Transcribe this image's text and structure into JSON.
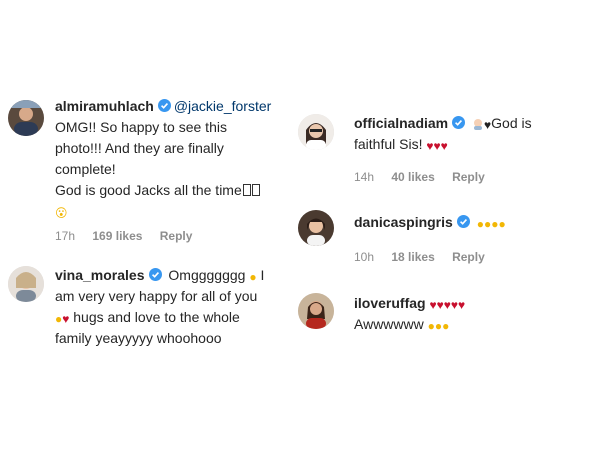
{
  "comments": [
    {
      "username": "almiramuhlach",
      "mention": "@jackie_forster",
      "lines": [
        "OMG!! So happy to see this",
        "photo!!! And they are finally",
        "complete!",
        "God is good Jacks all the time"
      ],
      "trailing_emoji": "😮",
      "time": "17h",
      "likes": "169 likes",
      "reply": "Reply"
    },
    {
      "username": "vina_morales",
      "text_start": "Omggggggg",
      "lines": [
        "I",
        "am very very happy for all of you",
        "hugs and love to the whole",
        "family yeayyyyy whoohooo"
      ],
      "time": "",
      "likes": "",
      "reply": ""
    },
    {
      "username": "officialnadiam",
      "text_end": "God is",
      "lines": [
        "faithful Sis!"
      ],
      "time": "14h",
      "likes": "40 likes",
      "reply": "Reply"
    },
    {
      "username": "danicaspingris",
      "time": "10h",
      "likes": "18 likes",
      "reply": "Reply"
    },
    {
      "username": "iloveruffag",
      "lines": [
        "Awwwwww"
      ],
      "time": "",
      "likes": "",
      "reply": ""
    }
  ],
  "colors": {
    "verified": "#3897f0",
    "link": "#00376b",
    "meta": "#8e8e8e",
    "heart": "#c8102e",
    "smile": "#f2b705"
  },
  "icons": {
    "verified": "verified-badge-icon",
    "smile": "smiley-emoji-icon",
    "heart": "red-heart-emoji-icon"
  }
}
